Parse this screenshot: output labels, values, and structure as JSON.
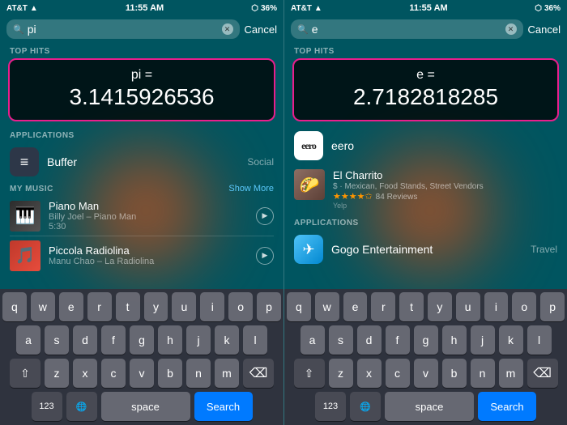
{
  "panel_left": {
    "status": {
      "carrier": "AT&T",
      "wifi": "●●●",
      "time": "11:55 AM",
      "bluetooth": "⬡",
      "battery_icon": "▮",
      "battery": "36%"
    },
    "search_query": "pi",
    "cancel_label": "Cancel",
    "top_hits_label": "TOP HITS",
    "top_hit": {
      "equation": "pi =",
      "value": "3.1415926536"
    },
    "applications_label": "APPLICATIONS",
    "app": {
      "name": "Buffer",
      "category": "Social"
    },
    "my_music_label": "MY MUSIC",
    "show_more_label": "Show More",
    "music_items": [
      {
        "title": "Piano Man",
        "subtitle": "Billy Joel – Piano Man",
        "duration": "5:30"
      },
      {
        "title": "Piccola Radiolina",
        "subtitle": "Manu Chao – La Radiolina"
      }
    ],
    "keyboard": {
      "rows": [
        [
          "q",
          "w",
          "e",
          "r",
          "t",
          "y",
          "u",
          "i",
          "o",
          "p"
        ],
        [
          "a",
          "s",
          "d",
          "f",
          "g",
          "h",
          "j",
          "k",
          "l"
        ],
        [
          "z",
          "x",
          "c",
          "v",
          "b",
          "n",
          "m"
        ]
      ],
      "num_label": "123",
      "globe_label": "🌐",
      "space_label": "space",
      "search_label": "Search"
    }
  },
  "panel_right": {
    "status": {
      "carrier": "AT&T",
      "wifi": "●●●",
      "time": "11:55 AM",
      "bluetooth": "⬡",
      "battery": "36%"
    },
    "search_query": "e",
    "cancel_label": "Cancel",
    "top_hits_label": "TOP HITS",
    "top_hit": {
      "equation": "e =",
      "value": "2.7182818285"
    },
    "top_hits_items": [
      {
        "name": "eero",
        "type": "app"
      }
    ],
    "restaurant": {
      "name": "El Charrito",
      "subtitle": "$ · Mexican, Food Stands, Street Vendors",
      "stars": "★★★★✩",
      "reviews": "84 Reviews",
      "source": "Yelp"
    },
    "applications_label": "APPLICATIONS",
    "app": {
      "name": "Gogo Entertainment",
      "category": "Travel"
    },
    "keyboard": {
      "rows": [
        [
          "q",
          "w",
          "e",
          "r",
          "t",
          "y",
          "u",
          "i",
          "o",
          "p"
        ],
        [
          "a",
          "s",
          "d",
          "f",
          "g",
          "h",
          "j",
          "k",
          "l"
        ],
        [
          "z",
          "x",
          "c",
          "v",
          "b",
          "n",
          "m"
        ]
      ],
      "num_label": "123",
      "globe_label": "🌐",
      "space_label": "space",
      "search_label": "Search"
    }
  }
}
